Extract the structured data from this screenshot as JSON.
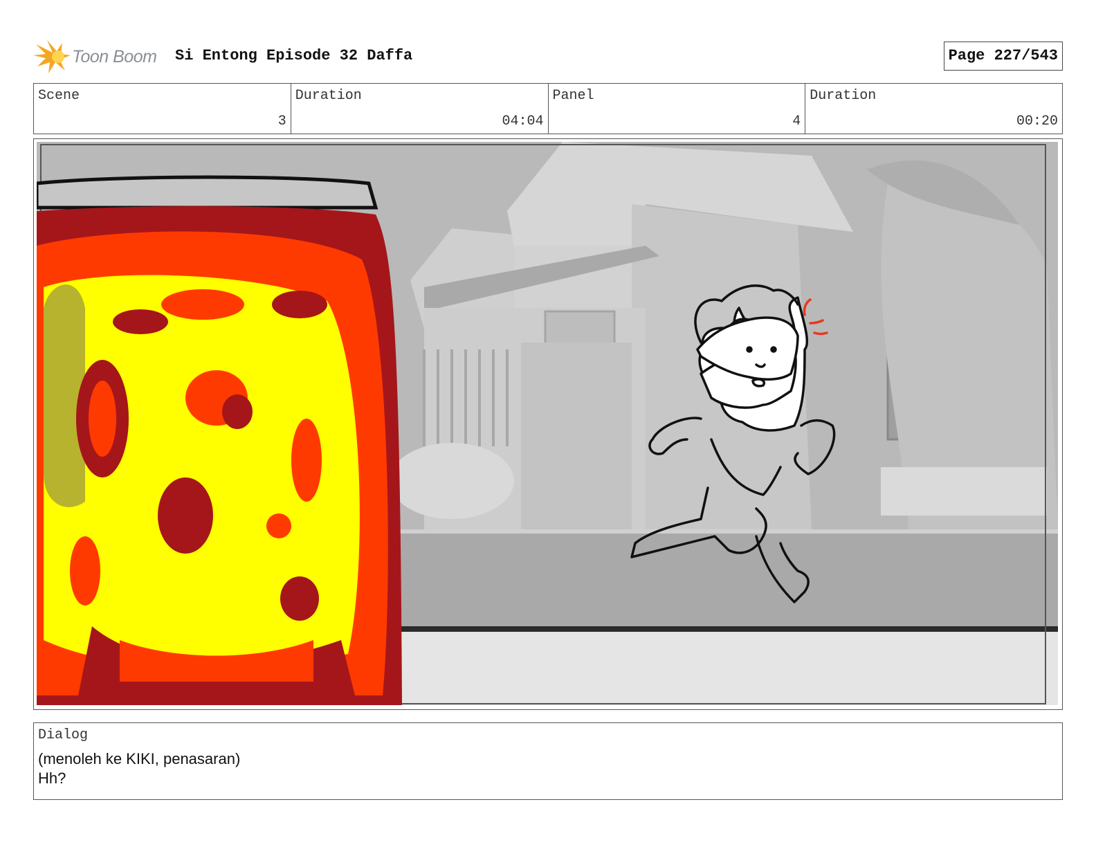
{
  "header": {
    "logo_text": "Toon Boom",
    "project_title": "Si Entong Episode 32 Daffa",
    "page": "Page 227/543"
  },
  "info": {
    "scene_label": "Scene",
    "scene_value": "3",
    "scene_duration_label": "Duration",
    "scene_duration_value": "04:04",
    "panel_label": "Panel",
    "panel_value": "4",
    "panel_duration_label": "Duration",
    "panel_duration_value": "00:20"
  },
  "dialog": {
    "label": "Dialog",
    "lines": "(menoleh ke KIKI, penasaran)\nHh?"
  },
  "colors": {
    "jar_dark_red": "#a5161a",
    "jar_red": "#ff3a00",
    "jar_yellow": "#ffff00",
    "logo_orange": "#f5a623",
    "background_gray": "#bdbdbd"
  }
}
